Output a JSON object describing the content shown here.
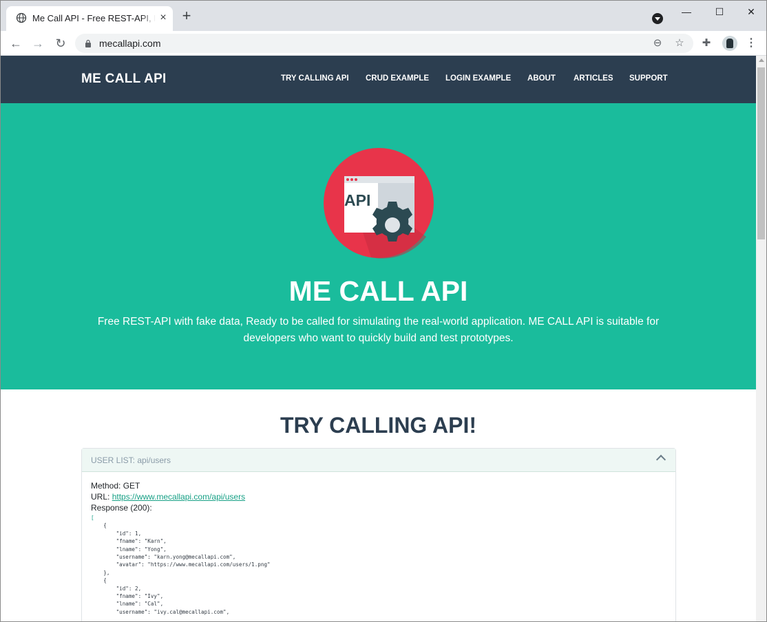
{
  "browser": {
    "tab_title": "Me Call API - Free REST-API, Ready to be called",
    "new_tab_symbol": "+",
    "url": "mecallapi.com",
    "window_controls": {
      "minimize": "—",
      "maximize": "☐",
      "close": "✕"
    }
  },
  "site_nav": {
    "brand": "ME CALL API",
    "links": [
      "TRY CALLING API",
      "CRUD EXAMPLE",
      "LOGIN EXAMPLE",
      "ABOUT",
      "ARTICLES",
      "SUPPORT"
    ]
  },
  "hero": {
    "logo_text": "API",
    "title": "ME CALL API",
    "description_line1": "Free REST-API with fake data, Ready to be called for simulating the real-world application. ME CALL API is suitable for",
    "description_line2": "developers who want to quickly build and test prototypes."
  },
  "try_section": {
    "title": "TRY CALLING API!",
    "card": {
      "header": "USER LIST: api/users",
      "method": "Method: GET",
      "url_prefix": "URL: ",
      "url_link": "https://www.mecallapi.com/api/users",
      "response_label": "Response (200):",
      "code_lines": [
        "[",
        "    {",
        "        \"id\": 1,",
        "        \"fname\": \"Karn\",",
        "        \"lname\": \"Yong\",",
        "        \"username\": \"karn.yong@mecallapi.com\",",
        "        \"avatar\": \"https://www.mecallapi.com/users/1.png\"",
        "    },",
        "    {",
        "        \"id\": 2,",
        "        \"fname\": \"Ivy\",",
        "        \"lname\": \"Cal\",",
        "        \"username\": \"ivy.cal@mecallapi.com\","
      ]
    }
  },
  "colors": {
    "nav_bg": "#2c3e50",
    "hero_bg": "#1abc9c",
    "accent": "#16a085",
    "logo_red": "#e8344a"
  }
}
